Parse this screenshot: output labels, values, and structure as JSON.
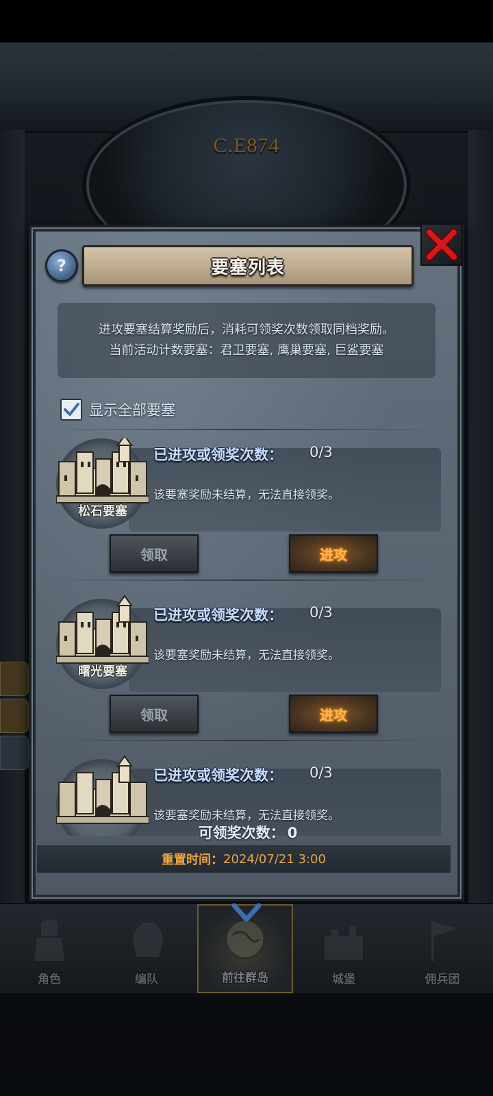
{
  "scene": {
    "clock_year": "C.E874"
  },
  "modal": {
    "title": "要塞列表",
    "help_icon": "?",
    "description_line1": "进攻要塞结算奖励后，消耗可领奖次数领取同档奖励。",
    "description_line2": "当前活动计数要塞：君卫要塞, 鹰巢要塞, 巨鲨要塞",
    "show_all_label": "显示全部要塞",
    "show_all_checked": true,
    "fortresses": [
      {
        "name": "松石要塞",
        "count_label": "已进攻或领奖次数：",
        "count_value": "0/3",
        "status": "该要塞奖励未结算，无法直接领奖。",
        "claim_label": "领取",
        "attack_label": "进攻"
      },
      {
        "name": "曙光要塞",
        "count_label": "已进攻或领奖次数：",
        "count_value": "0/3",
        "status": "该要塞奖励未结算，无法直接领奖。",
        "claim_label": "领取",
        "attack_label": "进攻"
      },
      {
        "name": "",
        "count_label": "已进攻或领奖次数：",
        "count_value": "0/3",
        "status": "该要塞奖励未结算，无法直接领奖。"
      }
    ],
    "claimable_label": "可领奖次数：",
    "claimable_value": "0",
    "reset_label": "重置时间：",
    "reset_value": "2024/07/21 3:00"
  },
  "nav": {
    "items": [
      {
        "label": "角色",
        "icon": "knight-icon"
      },
      {
        "label": "编队",
        "icon": "helmet-icon"
      },
      {
        "label": "前往群岛",
        "icon": "globe-icon",
        "active": true
      },
      {
        "label": "城堡",
        "icon": "castle-icon"
      },
      {
        "label": "佣兵团",
        "icon": "flag-icon"
      }
    ]
  },
  "colors": {
    "attack_text": "#ffb54a",
    "reset_label": "#f0a640",
    "count_label": "#c9dcff",
    "close_x": "#d21a1a"
  }
}
